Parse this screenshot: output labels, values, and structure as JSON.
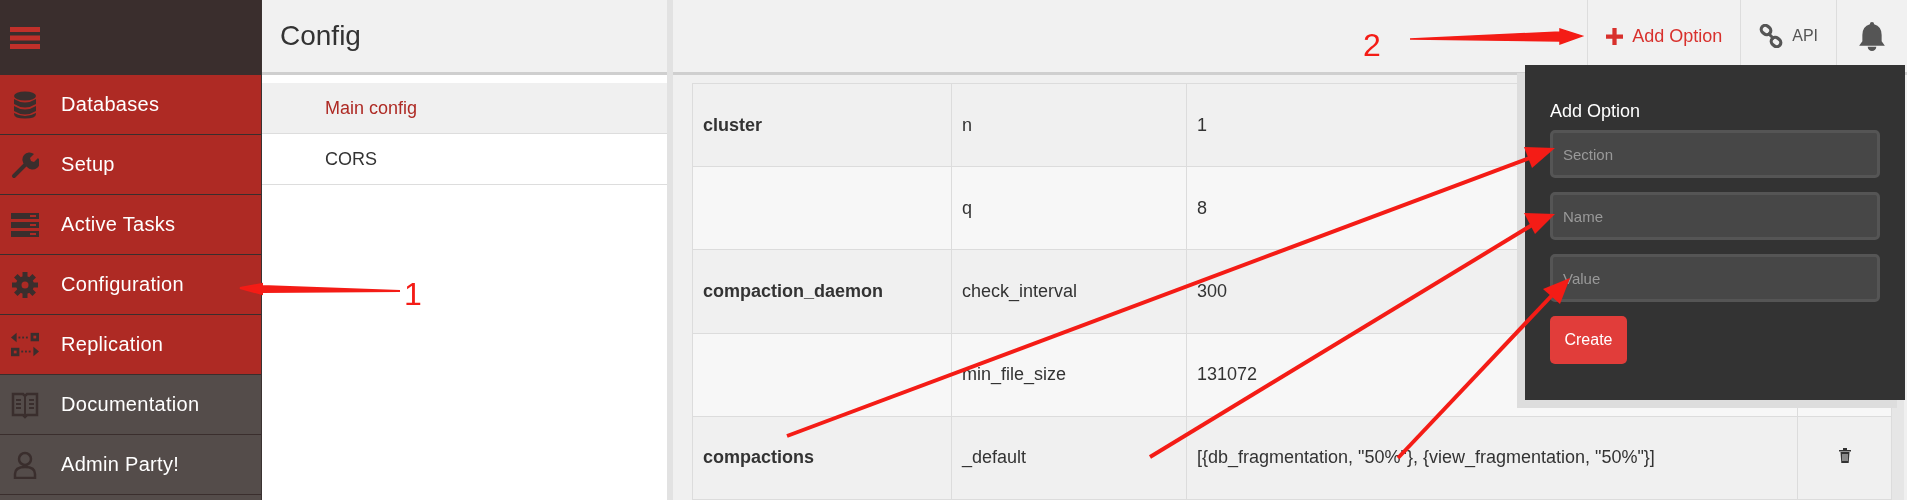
{
  "sidebar": {
    "items": [
      {
        "label": "Databases",
        "kind": "main"
      },
      {
        "label": "Setup",
        "kind": "main"
      },
      {
        "label": "Active Tasks",
        "kind": "main"
      },
      {
        "label": "Configuration",
        "kind": "main"
      },
      {
        "label": "Replication",
        "kind": "main"
      },
      {
        "label": "Documentation",
        "kind": "extra"
      },
      {
        "label": "Admin Party!",
        "kind": "extra"
      }
    ]
  },
  "page_title": "Config",
  "config_nav": [
    {
      "label": "Main config",
      "selected": true
    },
    {
      "label": "CORS",
      "selected": false
    }
  ],
  "toolbar": {
    "add_option": "Add Option",
    "api": "API"
  },
  "table": {
    "rows": [
      {
        "section": "cluster",
        "name": "n",
        "value": "1"
      },
      {
        "section": "",
        "name": "q",
        "value": "8"
      },
      {
        "section": "compaction_daemon",
        "name": "check_interval",
        "value": "300"
      },
      {
        "section": "",
        "name": "min_file_size",
        "value": "131072"
      },
      {
        "section": "compactions",
        "name": "_default",
        "value": "[{db_fragmentation, \"50%\"}, {view_fragmentation, \"50%\"}]"
      }
    ]
  },
  "popover": {
    "title": "Add Option",
    "fields": [
      {
        "placeholder": "Section"
      },
      {
        "placeholder": "Name"
      },
      {
        "placeholder": "Value"
      }
    ],
    "button": "Create"
  },
  "annotations": [
    {
      "label": "1"
    },
    {
      "label": "2"
    }
  ]
}
